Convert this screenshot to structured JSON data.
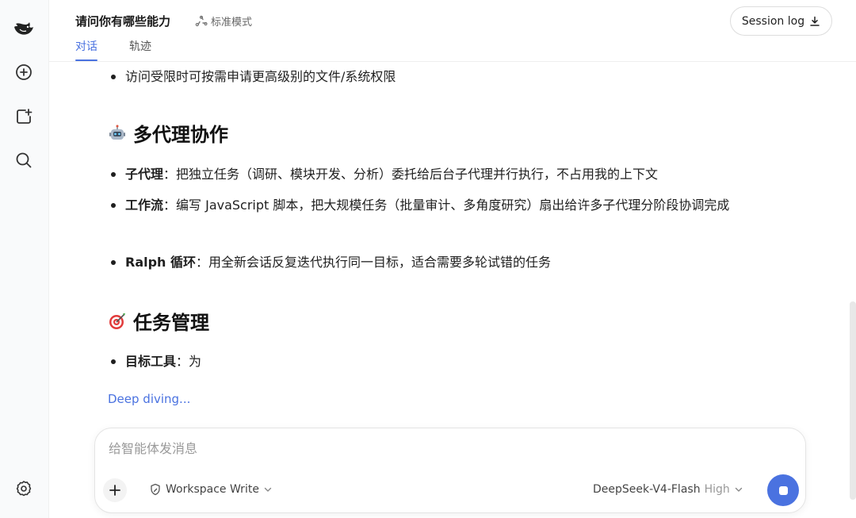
{
  "header": {
    "title": "请问你有哪些能力",
    "mode": "标准模式",
    "tabs": [
      {
        "label": "对话",
        "active": true
      },
      {
        "label": "轨迹",
        "active": false
      }
    ],
    "session_log": "Session log"
  },
  "sidebar": {
    "icons": [
      "whale-logo-icon",
      "new-chat-icon",
      "add-project-icon",
      "search-icon",
      "settings-icon"
    ]
  },
  "content": {
    "bullet_top": "访问受限时可按需申请更高级别的文件/系统权限",
    "section1": {
      "emoji": "robot-icon",
      "title": "多代理协作",
      "items": [
        {
          "label": "子代理",
          "text": "：把独立任务（调研、模块开发、分析）委托给后台子代理并行执行，不占用我的上下文"
        },
        {
          "label": "工作流",
          "text": "：编写 JavaScript 脚本，把大规模任务（批量审计、多角度研究）扇出给许多子代理分阶段协调完成"
        },
        {
          "label": "Ralph 循环",
          "text": "：用全新会话反复迭代执行同一目标，适合需要多轮试错的任务"
        }
      ]
    },
    "section2": {
      "emoji": "target-icon",
      "title": "任务管理",
      "items": [
        {
          "label": "目标工具",
          "text": "：为"
        }
      ]
    },
    "status": "Deep diving..."
  },
  "composer": {
    "placeholder": "给智能体发消息",
    "workspace": "Workspace Write",
    "model": "DeepSeek-V4-Flash",
    "level": "High"
  },
  "colors": {
    "accent": "#4a72e0",
    "sidebar_bg": "#f9fafb"
  }
}
